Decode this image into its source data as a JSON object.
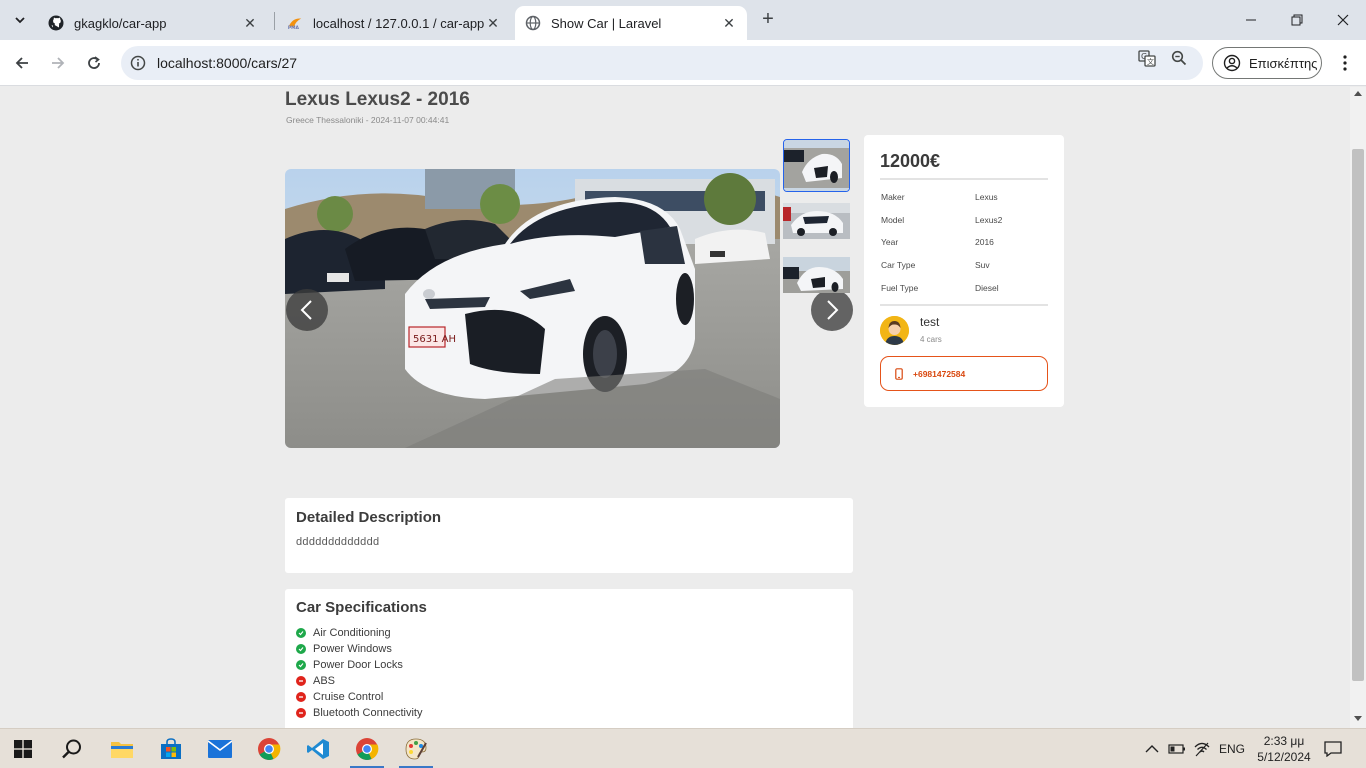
{
  "browser": {
    "tabs": [
      {
        "title": "gkagklo/car-app",
        "favicon": "github-icon"
      },
      {
        "title": "localhost / 127.0.0.1 / car-app |",
        "favicon": "phpmyadmin-icon"
      },
      {
        "title": "Show Car | Laravel",
        "favicon": "globe-icon",
        "active": true
      }
    ],
    "url": "localhost:8000/cars/27",
    "profile_label": "Επισκέπτης"
  },
  "car": {
    "title": "Lexus Lexus2 - 2016",
    "subtitle": "Greece Thessaloniki - 2024-11-07 00:44:41",
    "price": "12000€",
    "specs": [
      {
        "label": "Maker",
        "value": "Lexus"
      },
      {
        "label": "Model",
        "value": "Lexus2"
      },
      {
        "label": "Year",
        "value": "2016"
      },
      {
        "label": "Car Type",
        "value": "Suv"
      },
      {
        "label": "Fuel Type",
        "value": "Diesel"
      }
    ],
    "owner": {
      "name": "test",
      "cars": "4 cars"
    },
    "phone": "+6981472584"
  },
  "description": {
    "heading": "Detailed Description",
    "text": "ddddddddddddd"
  },
  "specifications": {
    "heading": "Car Specifications",
    "features": [
      {
        "label": "Air Conditioning",
        "available": true
      },
      {
        "label": "Power Windows",
        "available": true
      },
      {
        "label": "Power Door Locks",
        "available": true
      },
      {
        "label": "ABS",
        "available": false
      },
      {
        "label": "Cruise Control",
        "available": false
      },
      {
        "label": "Bluetooth Connectivity",
        "available": false
      }
    ]
  },
  "taskbar": {
    "language": "ENG",
    "time": "2:33 μμ",
    "date": "5/12/2024"
  },
  "colors": {
    "accent_phone": "#d9480f",
    "feature_ok": "#1ea84a",
    "feature_no": "#e0241c",
    "thumb_active_border": "#2563eb"
  }
}
